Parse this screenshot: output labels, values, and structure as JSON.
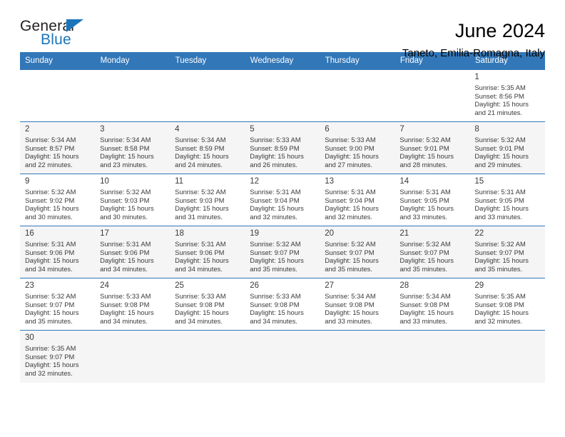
{
  "brand": {
    "name_top": "General",
    "name_bottom": "Blue",
    "accent_color": "#1b75bb",
    "triangle_icon": "triangle-icon"
  },
  "header": {
    "title": "June 2024",
    "subtitle": "Taneto, Emilia-Romagna, Italy"
  },
  "calendar": {
    "header_bg": "#3277b8",
    "header_text_color": "#ffffff",
    "weekdays": [
      "Sunday",
      "Monday",
      "Tuesday",
      "Wednesday",
      "Thursday",
      "Friday",
      "Saturday"
    ],
    "labels": {
      "sunrise": "Sunrise:",
      "sunset": "Sunset:",
      "daylight": "Daylight:"
    },
    "weeks": [
      [
        {
          "day": ""
        },
        {
          "day": ""
        },
        {
          "day": ""
        },
        {
          "day": ""
        },
        {
          "day": ""
        },
        {
          "day": ""
        },
        {
          "day": "1",
          "sunrise": "Sunrise: 5:35 AM",
          "sunset": "Sunset: 8:56 PM",
          "daylight1": "Daylight: 15 hours",
          "daylight2": "and 21 minutes."
        }
      ],
      [
        {
          "day": "2",
          "sunrise": "Sunrise: 5:34 AM",
          "sunset": "Sunset: 8:57 PM",
          "daylight1": "Daylight: 15 hours",
          "daylight2": "and 22 minutes."
        },
        {
          "day": "3",
          "sunrise": "Sunrise: 5:34 AM",
          "sunset": "Sunset: 8:58 PM",
          "daylight1": "Daylight: 15 hours",
          "daylight2": "and 23 minutes."
        },
        {
          "day": "4",
          "sunrise": "Sunrise: 5:34 AM",
          "sunset": "Sunset: 8:59 PM",
          "daylight1": "Daylight: 15 hours",
          "daylight2": "and 24 minutes."
        },
        {
          "day": "5",
          "sunrise": "Sunrise: 5:33 AM",
          "sunset": "Sunset: 8:59 PM",
          "daylight1": "Daylight: 15 hours",
          "daylight2": "and 26 minutes."
        },
        {
          "day": "6",
          "sunrise": "Sunrise: 5:33 AM",
          "sunset": "Sunset: 9:00 PM",
          "daylight1": "Daylight: 15 hours",
          "daylight2": "and 27 minutes."
        },
        {
          "day": "7",
          "sunrise": "Sunrise: 5:32 AM",
          "sunset": "Sunset: 9:01 PM",
          "daylight1": "Daylight: 15 hours",
          "daylight2": "and 28 minutes."
        },
        {
          "day": "8",
          "sunrise": "Sunrise: 5:32 AM",
          "sunset": "Sunset: 9:01 PM",
          "daylight1": "Daylight: 15 hours",
          "daylight2": "and 29 minutes."
        }
      ],
      [
        {
          "day": "9",
          "sunrise": "Sunrise: 5:32 AM",
          "sunset": "Sunset: 9:02 PM",
          "daylight1": "Daylight: 15 hours",
          "daylight2": "and 30 minutes."
        },
        {
          "day": "10",
          "sunrise": "Sunrise: 5:32 AM",
          "sunset": "Sunset: 9:03 PM",
          "daylight1": "Daylight: 15 hours",
          "daylight2": "and 30 minutes."
        },
        {
          "day": "11",
          "sunrise": "Sunrise: 5:32 AM",
          "sunset": "Sunset: 9:03 PM",
          "daylight1": "Daylight: 15 hours",
          "daylight2": "and 31 minutes."
        },
        {
          "day": "12",
          "sunrise": "Sunrise: 5:31 AM",
          "sunset": "Sunset: 9:04 PM",
          "daylight1": "Daylight: 15 hours",
          "daylight2": "and 32 minutes."
        },
        {
          "day": "13",
          "sunrise": "Sunrise: 5:31 AM",
          "sunset": "Sunset: 9:04 PM",
          "daylight1": "Daylight: 15 hours",
          "daylight2": "and 32 minutes."
        },
        {
          "day": "14",
          "sunrise": "Sunrise: 5:31 AM",
          "sunset": "Sunset: 9:05 PM",
          "daylight1": "Daylight: 15 hours",
          "daylight2": "and 33 minutes."
        },
        {
          "day": "15",
          "sunrise": "Sunrise: 5:31 AM",
          "sunset": "Sunset: 9:05 PM",
          "daylight1": "Daylight: 15 hours",
          "daylight2": "and 33 minutes."
        }
      ],
      [
        {
          "day": "16",
          "sunrise": "Sunrise: 5:31 AM",
          "sunset": "Sunset: 9:06 PM",
          "daylight1": "Daylight: 15 hours",
          "daylight2": "and 34 minutes."
        },
        {
          "day": "17",
          "sunrise": "Sunrise: 5:31 AM",
          "sunset": "Sunset: 9:06 PM",
          "daylight1": "Daylight: 15 hours",
          "daylight2": "and 34 minutes."
        },
        {
          "day": "18",
          "sunrise": "Sunrise: 5:31 AM",
          "sunset": "Sunset: 9:06 PM",
          "daylight1": "Daylight: 15 hours",
          "daylight2": "and 34 minutes."
        },
        {
          "day": "19",
          "sunrise": "Sunrise: 5:32 AM",
          "sunset": "Sunset: 9:07 PM",
          "daylight1": "Daylight: 15 hours",
          "daylight2": "and 35 minutes."
        },
        {
          "day": "20",
          "sunrise": "Sunrise: 5:32 AM",
          "sunset": "Sunset: 9:07 PM",
          "daylight1": "Daylight: 15 hours",
          "daylight2": "and 35 minutes."
        },
        {
          "day": "21",
          "sunrise": "Sunrise: 5:32 AM",
          "sunset": "Sunset: 9:07 PM",
          "daylight1": "Daylight: 15 hours",
          "daylight2": "and 35 minutes."
        },
        {
          "day": "22",
          "sunrise": "Sunrise: 5:32 AM",
          "sunset": "Sunset: 9:07 PM",
          "daylight1": "Daylight: 15 hours",
          "daylight2": "and 35 minutes."
        }
      ],
      [
        {
          "day": "23",
          "sunrise": "Sunrise: 5:32 AM",
          "sunset": "Sunset: 9:07 PM",
          "daylight1": "Daylight: 15 hours",
          "daylight2": "and 35 minutes."
        },
        {
          "day": "24",
          "sunrise": "Sunrise: 5:33 AM",
          "sunset": "Sunset: 9:08 PM",
          "daylight1": "Daylight: 15 hours",
          "daylight2": "and 34 minutes."
        },
        {
          "day": "25",
          "sunrise": "Sunrise: 5:33 AM",
          "sunset": "Sunset: 9:08 PM",
          "daylight1": "Daylight: 15 hours",
          "daylight2": "and 34 minutes."
        },
        {
          "day": "26",
          "sunrise": "Sunrise: 5:33 AM",
          "sunset": "Sunset: 9:08 PM",
          "daylight1": "Daylight: 15 hours",
          "daylight2": "and 34 minutes."
        },
        {
          "day": "27",
          "sunrise": "Sunrise: 5:34 AM",
          "sunset": "Sunset: 9:08 PM",
          "daylight1": "Daylight: 15 hours",
          "daylight2": "and 33 minutes."
        },
        {
          "day": "28",
          "sunrise": "Sunrise: 5:34 AM",
          "sunset": "Sunset: 9:08 PM",
          "daylight1": "Daylight: 15 hours",
          "daylight2": "and 33 minutes."
        },
        {
          "day": "29",
          "sunrise": "Sunrise: 5:35 AM",
          "sunset": "Sunset: 9:08 PM",
          "daylight1": "Daylight: 15 hours",
          "daylight2": "and 32 minutes."
        }
      ],
      [
        {
          "day": "30",
          "sunrise": "Sunrise: 5:35 AM",
          "sunset": "Sunset: 9:07 PM",
          "daylight1": "Daylight: 15 hours",
          "daylight2": "and 32 minutes."
        },
        {
          "day": ""
        },
        {
          "day": ""
        },
        {
          "day": ""
        },
        {
          "day": ""
        },
        {
          "day": ""
        },
        {
          "day": ""
        }
      ]
    ]
  }
}
